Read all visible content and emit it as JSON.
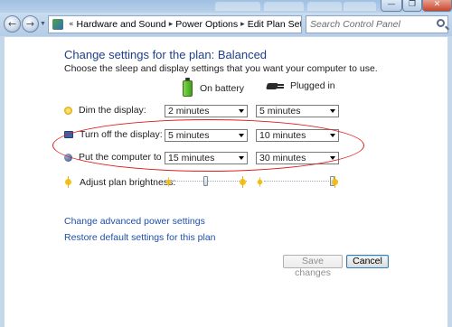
{
  "window": {
    "controls": {
      "minimize": "—",
      "maximize": "❐",
      "close": "✕"
    }
  },
  "nav": {
    "back_glyph": "←",
    "forward_glyph": "→",
    "dropdown_glyph": "▼",
    "refresh_glyph": "⟳"
  },
  "address": {
    "overflow": "«",
    "separator": "▸",
    "crumbs": [
      "Hardware and Sound",
      "Power Options",
      "Edit Plan Settings"
    ]
  },
  "search": {
    "placeholder": "Search Control Panel"
  },
  "page": {
    "title": "Change settings for the plan: Balanced",
    "subtitle": "Choose the sleep and display settings that you want your computer to use."
  },
  "columns": {
    "battery": "On battery",
    "plugged": "Plugged in"
  },
  "settings": [
    {
      "label": "Dim the display:",
      "battery": "2 minutes",
      "plugged": "5 minutes",
      "icon": "dim-display-icon"
    },
    {
      "label": "Turn off the display:",
      "battery": "5 minutes",
      "plugged": "10 minutes",
      "icon": "display-icon"
    },
    {
      "label": "Put the computer to sleep:",
      "battery": "15 minutes",
      "plugged": "30 minutes",
      "icon": "sleep-icon"
    }
  ],
  "brightness": {
    "label": "Adjust plan brightness:",
    "battery_level": 0.45,
    "plugged_level": 0.97
  },
  "links": {
    "advanced": "Change advanced power settings",
    "restore": "Restore default settings for this plan"
  },
  "buttons": {
    "save": "Save changes",
    "cancel": "Cancel"
  },
  "colors": {
    "heading": "#1f3f88",
    "link": "#1f4fa8",
    "highlight": "#e01b1b"
  }
}
